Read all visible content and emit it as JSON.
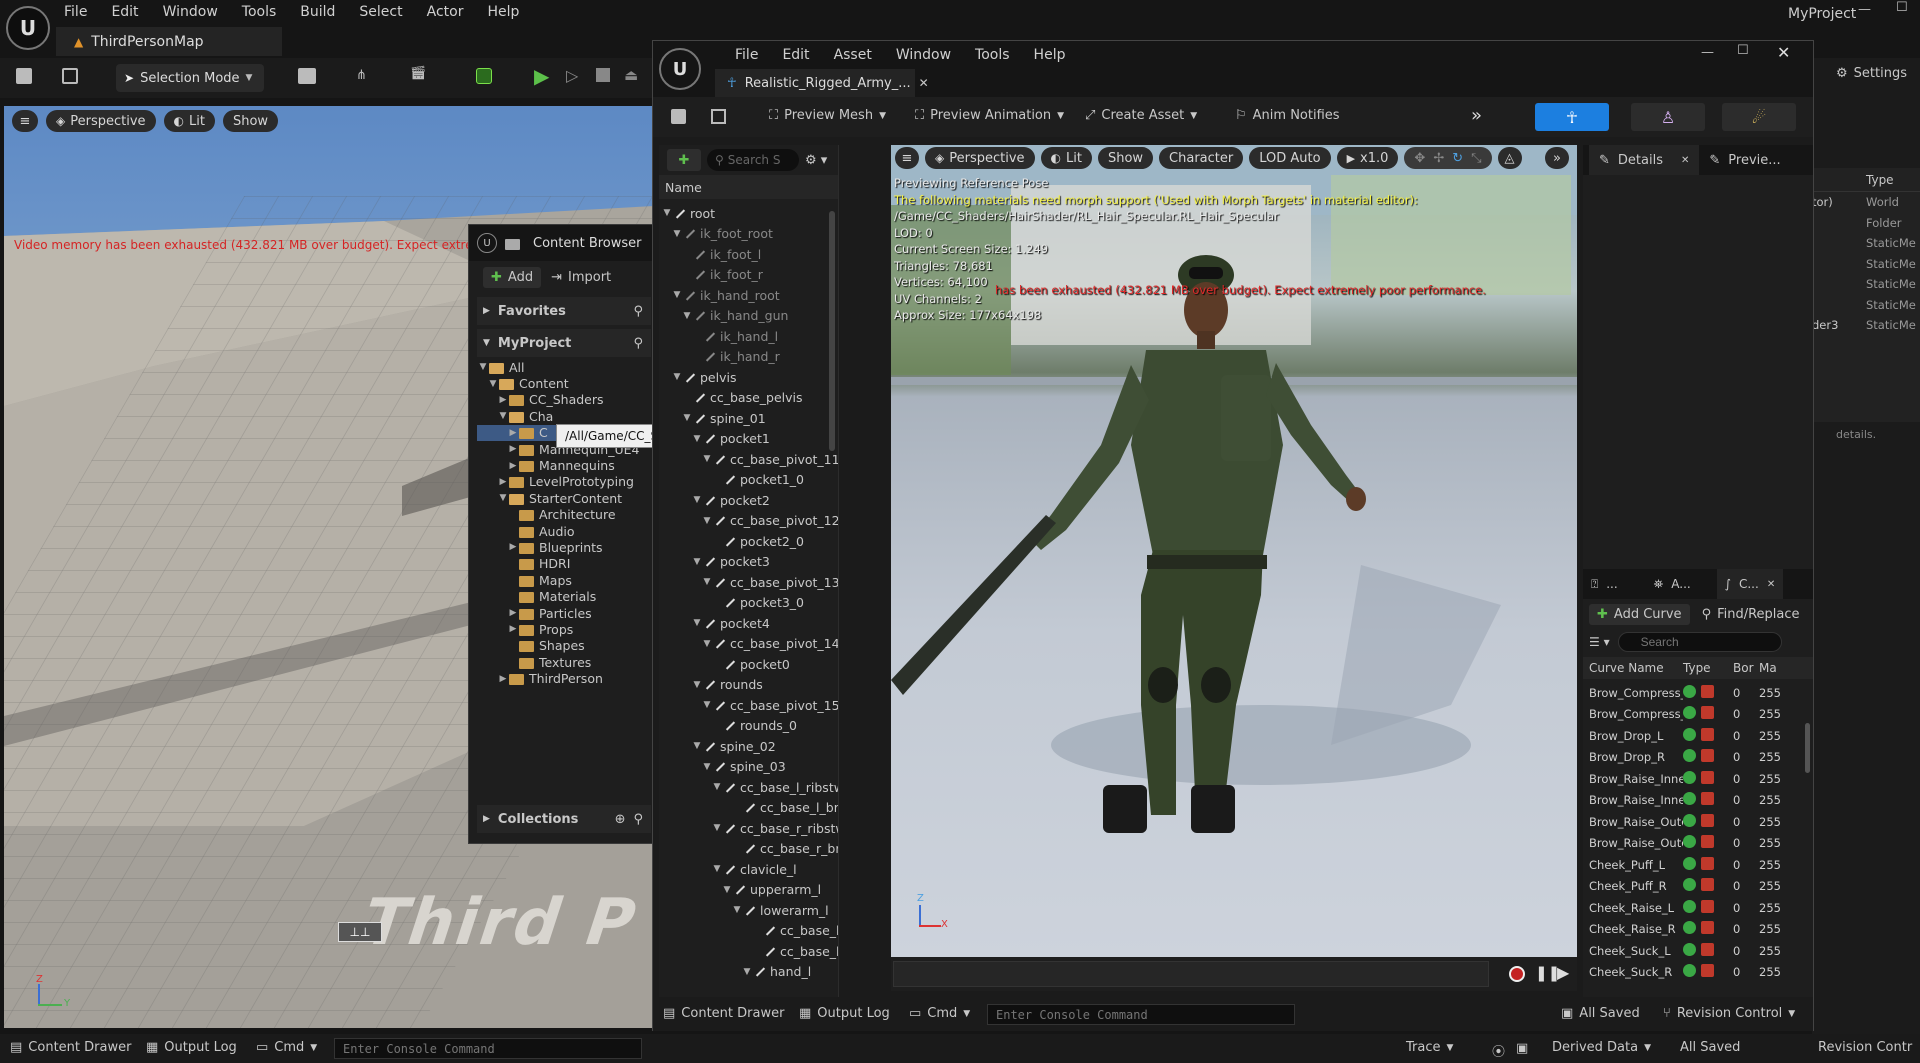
{
  "main": {
    "menu": [
      "File",
      "Edit",
      "Window",
      "Tools",
      "Build",
      "Select",
      "Actor",
      "Help"
    ],
    "project_name": "MyProject",
    "map_tab": "ThirdPersonMap",
    "selection_mode": "Selection Mode",
    "viewport": {
      "perspective": "Perspective",
      "lit": "Lit",
      "show": "Show"
    },
    "vram_warning": "Video memory has been exhausted (432.821 MB over budget). Expect extreme",
    "settings_label": "Settings",
    "floor_text": "Third P"
  },
  "content_browser": {
    "title": "Content Browser",
    "add_label": "Add",
    "import_label": "Import",
    "favorites": "Favorites",
    "project": "MyProject",
    "collections": "Collections",
    "tooltip": "/All/Game/CC_Shaders",
    "tree": [
      "All",
      "Content",
      "CC_Shaders",
      "Cha",
      "C",
      "Mannequin_UE4",
      "Mannequins",
      "LevelPrototyping",
      "StarterContent",
      "Architecture",
      "Audio",
      "Blueprints",
      "HDRI",
      "Maps",
      "Materials",
      "Particles",
      "Props",
      "Shapes",
      "Textures",
      "ThirdPerson"
    ]
  },
  "editor": {
    "menu": [
      "File",
      "Edit",
      "Asset",
      "Window",
      "Tools",
      "Help"
    ],
    "tab_title": "Realistic_Rigged_Army_...",
    "toolbar": {
      "preview_mesh": "Preview Mesh",
      "preview_animation": "Preview Animation",
      "create_asset": "Create Asset",
      "anim_notifies": "Anim Notifies"
    },
    "search_placeholder": "Search S",
    "tree_header": "Name",
    "bones": [
      "root",
      "ik_foot_root",
      "ik_foot_l",
      "ik_foot_r",
      "ik_hand_root",
      "ik_hand_gun",
      "ik_hand_l",
      "ik_hand_r",
      "pelvis",
      "cc_base_pelvis",
      "spine_01",
      "pocket1",
      "cc_base_pivot_11",
      "pocket1_0",
      "pocket2",
      "cc_base_pivot_12",
      "pocket2_0",
      "pocket3",
      "cc_base_pivot_13",
      "pocket3_0",
      "pocket4",
      "cc_base_pivot_14",
      "pocket0",
      "rounds",
      "cc_base_pivot_15",
      "rounds_0",
      "spine_02",
      "spine_03",
      "cc_base_l_ribstwist",
      "cc_base_l_breast",
      "cc_base_r_ribstwist",
      "cc_base_r_breast",
      "clavicle_l",
      "upperarm_l",
      "lowerarm_l",
      "cc_base_l_elbow",
      "cc_base_l_forearm",
      "hand_l"
    ],
    "viewport": {
      "perspective": "Perspective",
      "lit": "Lit",
      "show": "Show",
      "character": "Character",
      "lod": "LOD Auto",
      "speed": "x1.0",
      "overlay": [
        "Previewing Reference Pose",
        "The following materials need morph support ('Used with Morph Targets' in material editor):",
        "/Game/CC_Shaders/HairShader/RL_Hair_Specular.RL_Hair_Specular",
        "LOD: 0",
        "Current Screen Size: 1.249",
        "Triangles: 78,681",
        "Vertices: 64,100",
        "UV Channels: 2",
        "Approx Size: 177x64x198"
      ],
      "vram_warning": "has been exhausted (432.821 MB over budget). Expect extremely poor performance."
    },
    "details_tab": "Details",
    "preview_tab": "Previe...",
    "bottom_tabs": [
      "...",
      "A...",
      "C..."
    ],
    "add_curve": "Add Curve",
    "find_replace": "Find/Replace",
    "curve_search": "Search",
    "curve_headers": [
      "Curve Name",
      "Type",
      "Bor",
      "Ma"
    ],
    "curves": [
      {
        "name": "Brow_Compress_L",
        "b": "0",
        "m": "255"
      },
      {
        "name": "Brow_Compress_R",
        "b": "0",
        "m": "255"
      },
      {
        "name": "Brow_Drop_L",
        "b": "0",
        "m": "255"
      },
      {
        "name": "Brow_Drop_R",
        "b": "0",
        "m": "255"
      },
      {
        "name": "Brow_Raise_Inner_L",
        "b": "0",
        "m": "255"
      },
      {
        "name": "Brow_Raise_Inner_R",
        "b": "0",
        "m": "255"
      },
      {
        "name": "Brow_Raise_Outer_L",
        "b": "0",
        "m": "255"
      },
      {
        "name": "Brow_Raise_Outer_R",
        "b": "0",
        "m": "255"
      },
      {
        "name": "Cheek_Puff_L",
        "b": "0",
        "m": "255"
      },
      {
        "name": "Cheek_Puff_R",
        "b": "0",
        "m": "255"
      },
      {
        "name": "Cheek_Raise_L",
        "b": "0",
        "m": "255"
      },
      {
        "name": "Cheek_Raise_R",
        "b": "0",
        "m": "255"
      },
      {
        "name": "Cheek_Suck_L",
        "b": "0",
        "m": "255"
      },
      {
        "name": "Cheek_Suck_R",
        "b": "0",
        "m": "255"
      }
    ],
    "status": {
      "content_drawer": "Content Drawer",
      "output_log": "Output Log",
      "cmd": "Cmd",
      "console_placeholder": "Enter Console Command",
      "all_saved": "All Saved",
      "revision": "Revision Control"
    }
  },
  "right_panel": {
    "type_header": "Type",
    "items": [
      {
        "a": "tor)",
        "b": "World"
      },
      {
        "a": "",
        "b": "Folder"
      },
      {
        "a": "",
        "b": "StaticMe"
      },
      {
        "a": "",
        "b": "StaticMe"
      },
      {
        "a": "",
        "b": "StaticMe"
      },
      {
        "a": "",
        "b": "StaticMe"
      },
      {
        "a": "der3",
        "b": "StaticMe"
      }
    ],
    "details_hint": "details."
  },
  "main_status": {
    "content_drawer": "Content Drawer",
    "output_log": "Output Log",
    "cmd": "Cmd",
    "console_placeholder": "Enter Console Command",
    "trace": "Trace",
    "derived_data": "Derived Data",
    "all_saved": "All Saved",
    "revision": "Revision Contr"
  }
}
